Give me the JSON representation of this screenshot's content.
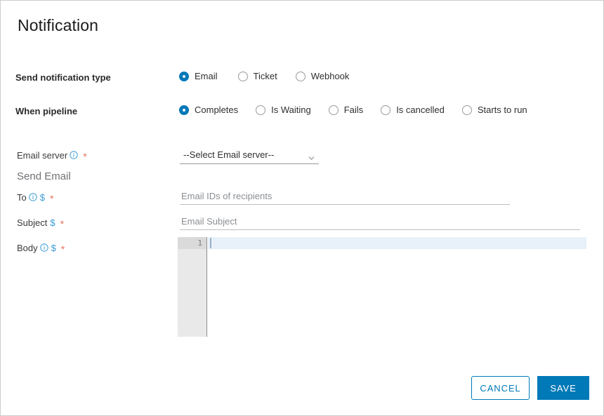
{
  "window": {
    "title": "Notification"
  },
  "form": {
    "notification_type": {
      "label": "Send notification type",
      "options": [
        {
          "label": "Email",
          "selected": true
        },
        {
          "label": "Ticket",
          "selected": false
        },
        {
          "label": "Webhook",
          "selected": false
        }
      ]
    },
    "when_pipeline": {
      "label": "When pipeline",
      "options": [
        {
          "label": "Completes",
          "selected": true
        },
        {
          "label": "Is Waiting",
          "selected": false
        },
        {
          "label": "Fails",
          "selected": false
        },
        {
          "label": "Is cancelled",
          "selected": false
        },
        {
          "label": "Starts to run",
          "selected": false
        }
      ]
    },
    "email_server": {
      "label": "Email server",
      "info_icon": "info-circle-icon",
      "required_marker": "*",
      "selected_value": "--Select Email server--",
      "chevron_icon": "chevron-down-icon"
    },
    "section_send_email": "Send Email",
    "to": {
      "label": "To",
      "info_icon": "info-circle-icon",
      "variable_marker": "$",
      "required_marker": "*",
      "value": "",
      "placeholder": "Email IDs of recipients"
    },
    "subject": {
      "label": "Subject",
      "variable_marker": "$",
      "required_marker": "*",
      "value": "",
      "placeholder": "Email Subject"
    },
    "body": {
      "label": "Body",
      "info_icon": "info-circle-icon",
      "variable_marker": "$",
      "required_marker": "*",
      "editor_line_number": "1",
      "editor_content": ""
    }
  },
  "footer": {
    "cancel_label": "CANCEL",
    "save_label": "SAVE"
  },
  "colors": {
    "accent": "#0079b8",
    "info_icon": "#3a9bd5",
    "variable": "#3a9bd5",
    "required": "#e8705a",
    "active_line": "#e8f1fa",
    "gutter": "#e9e9e9"
  }
}
